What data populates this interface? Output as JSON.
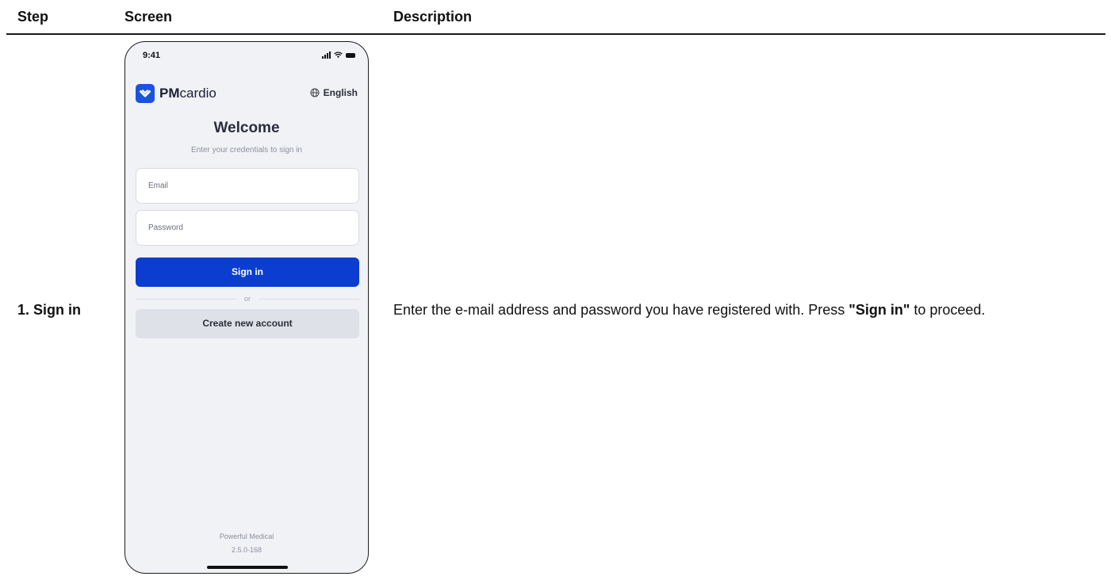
{
  "table": {
    "headers": {
      "step": "Step",
      "screen": "Screen",
      "description": "Description"
    },
    "rows": [
      {
        "step": "1. Sign in",
        "description_before": "Enter the e-mail address and password you have registered with. Press ",
        "description_bold": "\"Sign in\"",
        "description_after": " to proceed."
      }
    ]
  },
  "phone": {
    "status_time": "9:41",
    "logo_bold": "PM",
    "logo_rest": "cardio",
    "language": "English",
    "title": "Welcome",
    "subtitle": "Enter your credentials to sign in",
    "email_placeholder": "Email",
    "password_placeholder": "Password",
    "sign_in_label": "Sign in",
    "or_label": "or",
    "create_account_label": "Create new account",
    "footer_company": "Powerful Medical",
    "footer_version": "2.5.0-168",
    "colors": {
      "primary": "#0a3dd0",
      "background": "#f1f2f6",
      "secondary_button": "#dfe1e8"
    },
    "icons": {
      "logo": "heart-logo-icon",
      "language": "globe-icon",
      "signal": "signal-icon",
      "wifi": "wifi-icon",
      "battery": "battery-icon"
    }
  }
}
